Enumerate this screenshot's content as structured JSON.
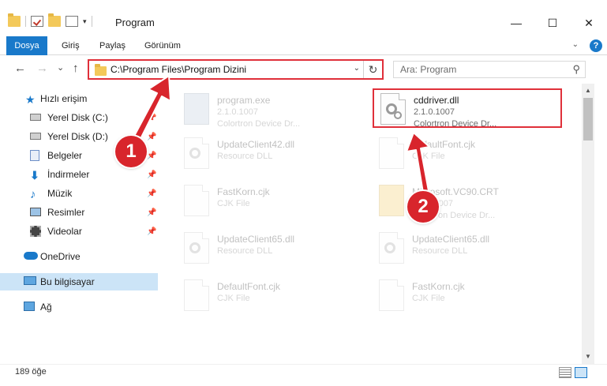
{
  "window": {
    "title": "Program",
    "controls": {
      "minimize": "—",
      "maximize": "☐",
      "close": "✕"
    }
  },
  "ribbon": {
    "tabs": [
      "Dosya",
      "Giriş",
      "Paylaş",
      "Görünüm"
    ],
    "help": "?"
  },
  "nav": {
    "back": "←",
    "forward": "→",
    "recent": "⌄",
    "up": "↑",
    "address": "C:\\Program Files\\Program Dizini",
    "search_placeholder": "Ara: Program"
  },
  "sidebar": {
    "items": [
      {
        "label": "Hızlı erişim",
        "icon": "star-icon"
      },
      {
        "label": "Yerel Disk (C:)",
        "icon": "drive-icon",
        "pinned": true
      },
      {
        "label": "Yerel Disk (D:)",
        "icon": "drive-icon",
        "pinned": true
      },
      {
        "label": "Belgeler",
        "icon": "documents-icon",
        "pinned": true
      },
      {
        "label": "İndirmeler",
        "icon": "download-icon",
        "pinned": true
      },
      {
        "label": "Müzik",
        "icon": "music-icon",
        "pinned": true
      },
      {
        "label": "Resimler",
        "icon": "pictures-icon",
        "pinned": true
      },
      {
        "label": "Videolar",
        "icon": "videos-icon",
        "pinned": true
      },
      {
        "label": "OneDrive",
        "icon": "cloud-icon"
      },
      {
        "label": "Bu bilgisayar",
        "icon": "computer-icon",
        "selected": true
      },
      {
        "label": "Ağ",
        "icon": "network-icon"
      }
    ]
  },
  "files": [
    {
      "name": "program.exe",
      "line1": "2.1.0.1007",
      "line2": "Colortron Device Dr...",
      "faded": true
    },
    {
      "name": "cddriver.dll",
      "line1": "2.1.0.1007",
      "line2": "Colortron Device Dr...",
      "faded": false,
      "highlighted": true
    },
    {
      "name": "UpdateClient42.dll",
      "line1": "Resource DLL",
      "line2": "",
      "faded": true
    },
    {
      "name": "DefaultFont.cjk",
      "line1": "CJK File",
      "line2": "",
      "faded": true
    },
    {
      "name": "FastKorn.cjk",
      "line1": "CJK File",
      "line2": "",
      "faded": true
    },
    {
      "name": "Microsoft.VC90.CRT",
      "line1": "2.1.0.1007",
      "line2": "Colortron Device Dr...",
      "faded": true
    },
    {
      "name": "UpdateClient65.dll",
      "line1": "Resource DLL",
      "line2": "",
      "faded": true
    },
    {
      "name": "UpdateClient65.dll",
      "line1": "Resource DLL",
      "line2": "",
      "faded": true
    },
    {
      "name": "DefaultFont.cjk",
      "line1": "CJK File",
      "line2": "",
      "faded": true
    },
    {
      "name": "FastKorn.cjk",
      "line1": "CJK File",
      "line2": "",
      "faded": true
    }
  ],
  "status": {
    "count": "189 öğe"
  },
  "annotations": {
    "step1": "1",
    "step2": "2",
    "color": "#d8252c"
  }
}
